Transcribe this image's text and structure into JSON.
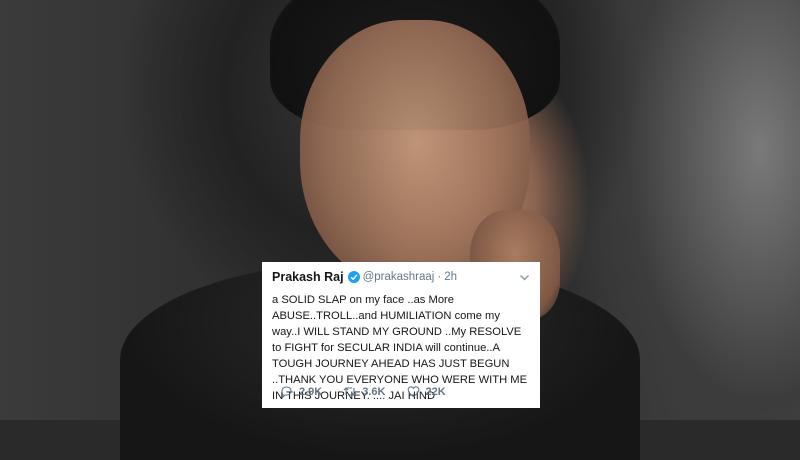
{
  "tweet": {
    "author_name": "Prakash Raj",
    "handle": "@prakashraaj",
    "separator": "·",
    "time": "2h",
    "text": "a SOLID SLAP on my face ..as More ABUSE..TROLL..and HUMILIATION come my way..I WILL STAND MY GROUND ..My RESOLVE to FIGHT for SECULAR INDIA will continue..A TOUGH JOURNEY AHEAD HAS JUST BEGUN ..THANK YOU EVERYONE WHO WERE WITH ME IN THIS JOURNEY. .... JAI HIND",
    "actions": {
      "replies": "2.9K",
      "retweets": "3.6K",
      "likes": "22K"
    }
  },
  "colors": {
    "verified": "#1da1f2",
    "muted": "#657786",
    "text": "#14171a"
  },
  "icons": [
    "verified-badge-icon",
    "chevron-down-icon",
    "reply-icon",
    "retweet-icon",
    "like-icon"
  ]
}
